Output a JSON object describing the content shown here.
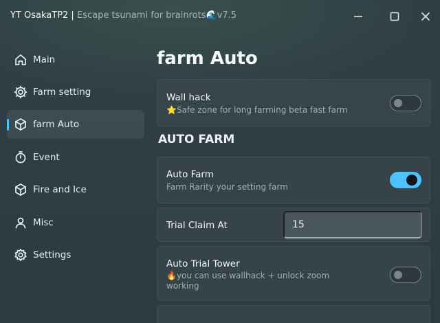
{
  "window": {
    "title": "YT OsakaTP2 |",
    "subtitle_prefix": "Escape tsunami for brainrots",
    "subtitle_icon": "🌊",
    "version": "v7.5"
  },
  "sidebar": {
    "items": [
      {
        "label": "Main",
        "icon": "home-icon"
      },
      {
        "label": "Farm setting",
        "icon": "gear-cog-icon"
      },
      {
        "label": "farm Auto",
        "icon": "cube-icon",
        "active": true
      },
      {
        "label": "Event",
        "icon": "stopwatch-icon"
      },
      {
        "label": "Fire and Ice",
        "icon": "cube-icon"
      },
      {
        "label": "Misc",
        "icon": "user-icon"
      },
      {
        "label": "Settings",
        "icon": "settings-icon"
      }
    ]
  },
  "main": {
    "title": "farm Auto",
    "wall_hack": {
      "title": "Wall hack",
      "desc_icon": "⭐",
      "desc": "Safe zone for long farming beta fast farm",
      "enabled": false
    },
    "section_title": "AUTO FARM",
    "auto_farm": {
      "title": "Auto Farm",
      "desc": "Farm Rarity your setting farm",
      "enabled": true
    },
    "trial_claim": {
      "title": "Trial Claim At",
      "value": "15"
    },
    "auto_trial_tower": {
      "title": "Auto Trial Tower",
      "desc_icon": "🔥",
      "desc": "you can use wallhack + unlock zoom working",
      "enabled": false
    }
  },
  "colors": {
    "accent": "#4cc2ff",
    "background": "#2e3f44",
    "card": "#3a464c"
  }
}
